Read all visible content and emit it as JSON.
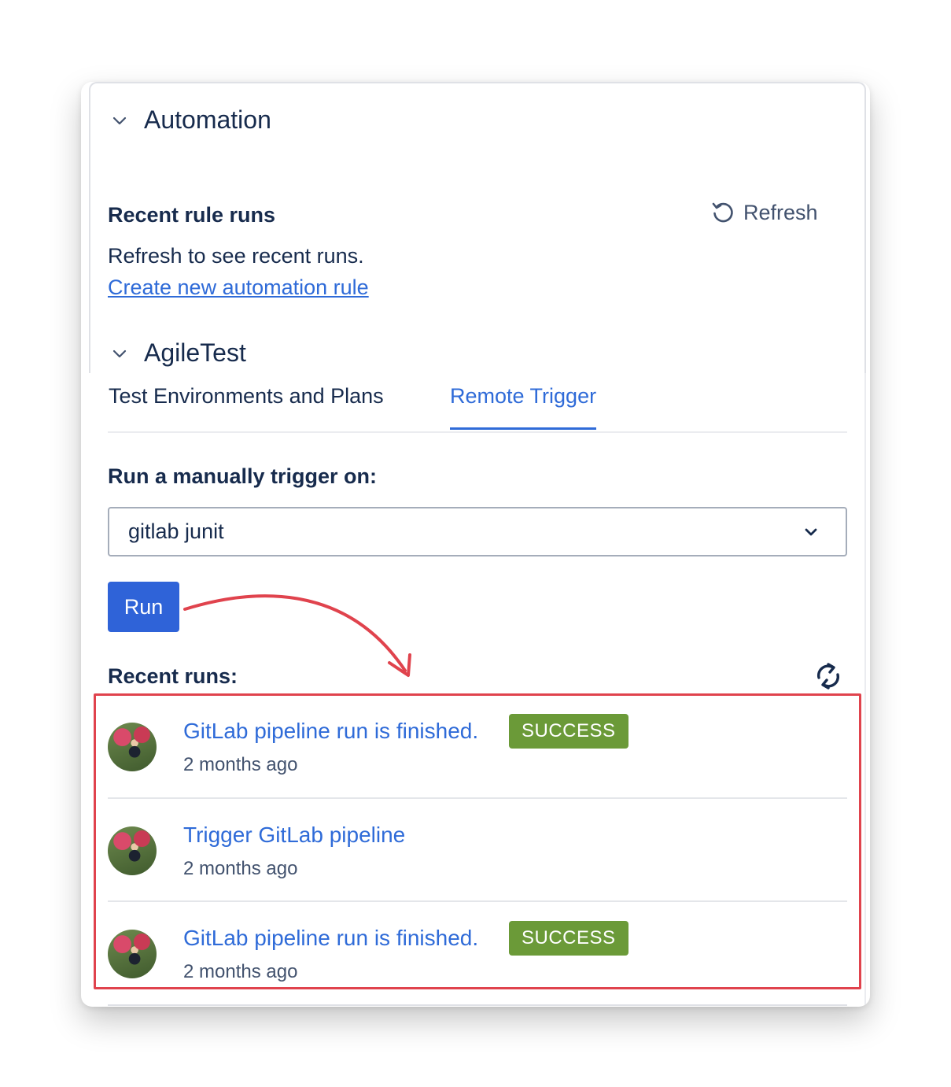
{
  "automation": {
    "title": "Automation",
    "recent_rule_runs_label": "Recent rule runs",
    "refresh_label": "Refresh",
    "empty_text": "Refresh to see recent runs.",
    "create_link": "Create new automation rule"
  },
  "agiletest": {
    "title": "AgileTest",
    "tabs": [
      {
        "label": "Test Environments and Plans",
        "active": false
      },
      {
        "label": "Remote Trigger",
        "active": true
      }
    ],
    "trigger_label": "Run a manually trigger on:",
    "select_value": "gitlab junit",
    "run_label": "Run",
    "recent_runs_label": "Recent runs:",
    "runs": [
      {
        "title": "GitLab pipeline run is finished.",
        "status": "SUCCESS",
        "time": "2 months ago"
      },
      {
        "title": "Trigger GitLab pipeline",
        "status": "",
        "time": "2 months ago"
      },
      {
        "title": "GitLab pipeline run is finished.",
        "status": "SUCCESS",
        "time": "2 months ago"
      }
    ]
  },
  "colors": {
    "accent": "#2f6bd8",
    "success": "#6b9a38",
    "highlight": "#e0434d"
  }
}
